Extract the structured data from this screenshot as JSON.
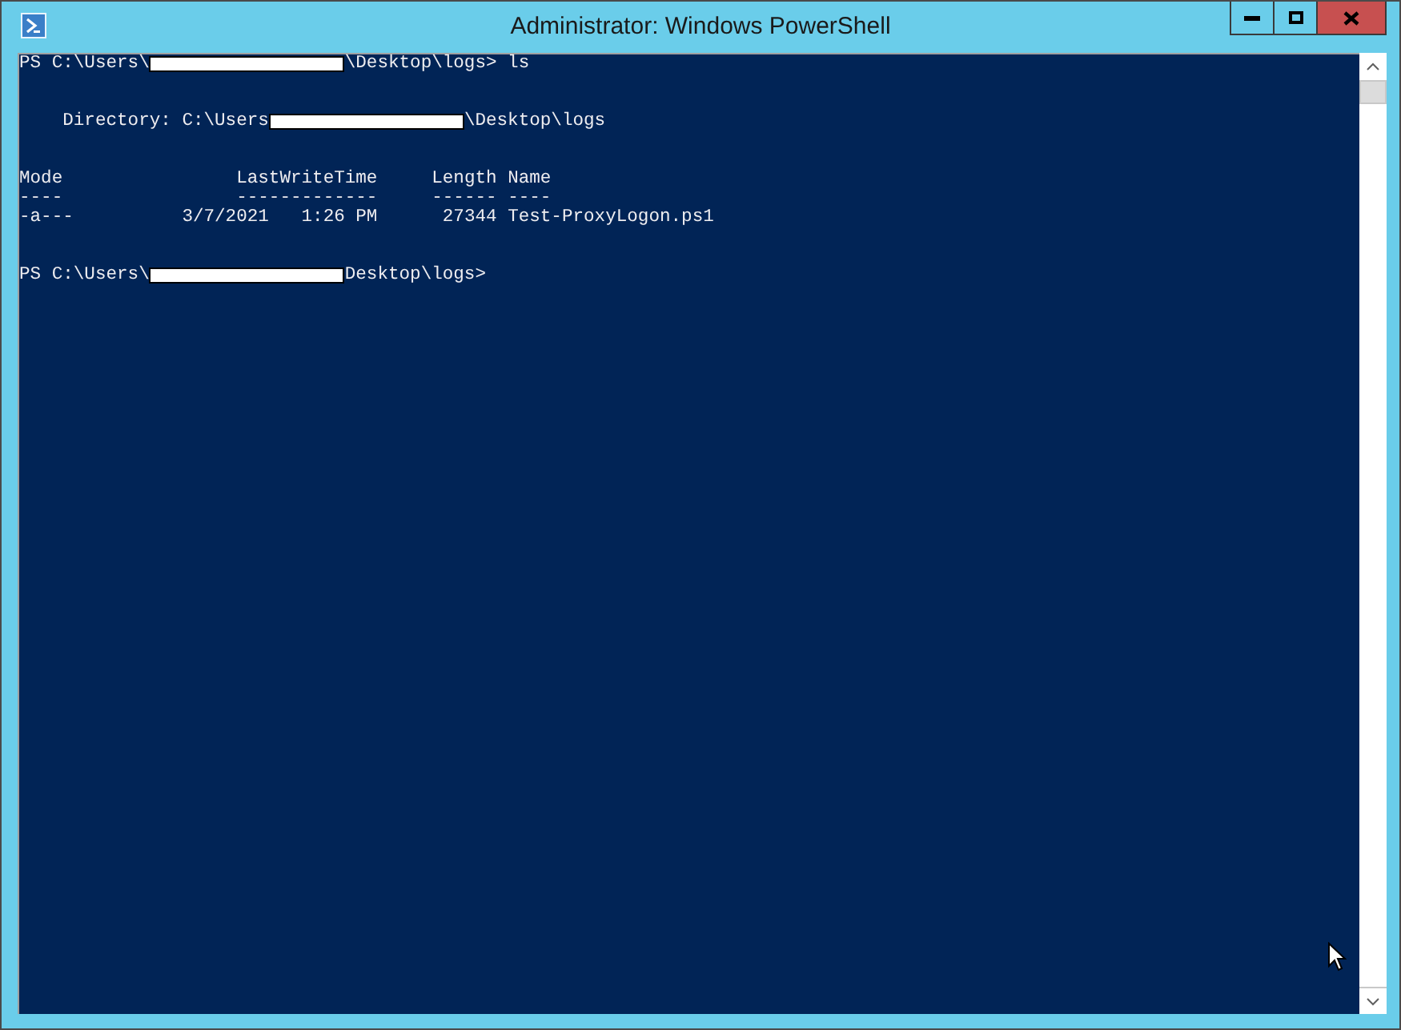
{
  "window": {
    "title": "Administrator: Windows PowerShell"
  },
  "console": {
    "blocks": [
      [
        [
          {
            "kind": "text",
            "text": "PS C:\\Users\\"
          },
          {
            "kind": "redacted"
          },
          {
            "kind": "text",
            "text": "\\Desktop\\logs> ls"
          }
        ]
      ],
      [
        [
          {
            "kind": "text",
            "text": "    Directory: C:\\Users"
          },
          {
            "kind": "redacted"
          },
          {
            "kind": "text",
            "text": "\\Desktop\\logs"
          }
        ]
      ],
      [
        [
          {
            "kind": "text",
            "text": "Mode                LastWriteTime     Length Name"
          }
        ],
        [
          {
            "kind": "text",
            "text": "----                -------------     ------ ----"
          }
        ],
        [
          {
            "kind": "text",
            "text": "-a---          3/7/2021   1:26 PM      27344 Test-ProxyLogon.ps1"
          }
        ]
      ],
      [
        [
          {
            "kind": "text",
            "text": "PS C:\\Users\\"
          },
          {
            "kind": "redacted"
          },
          {
            "kind": "text",
            "text": "Desktop\\logs>"
          }
        ]
      ]
    ]
  }
}
